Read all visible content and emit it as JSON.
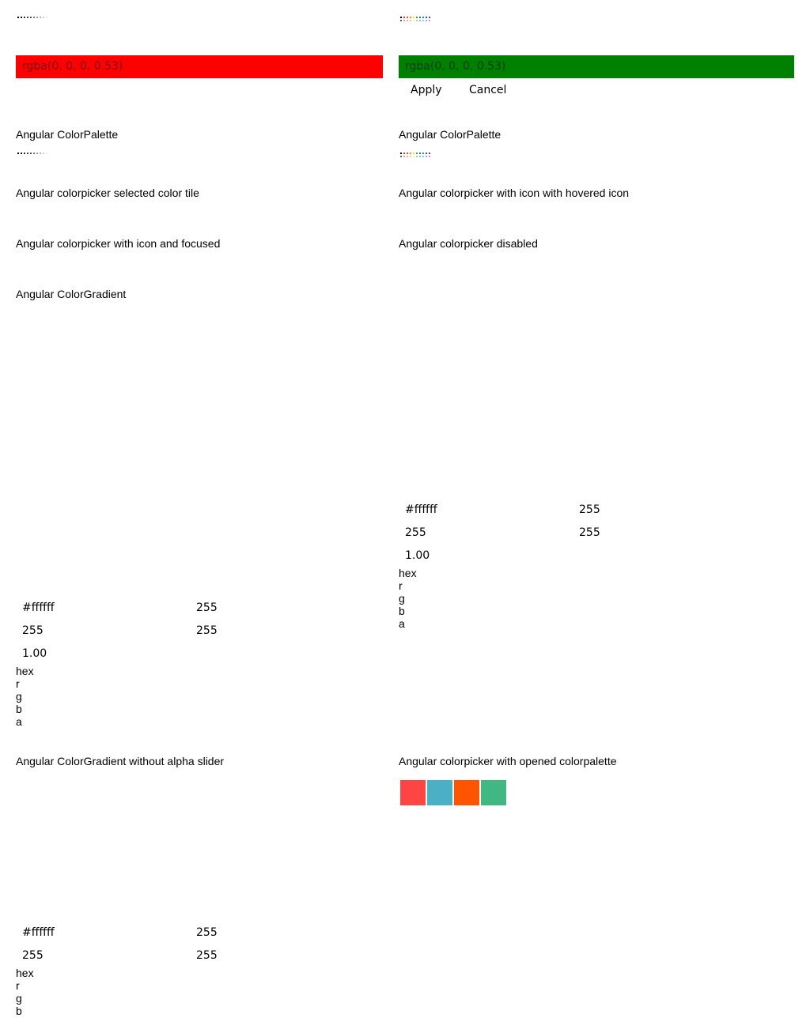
{
  "top_left": {
    "dots": [
      "#000",
      "#111",
      "#333",
      "#444",
      "#555",
      "#777",
      "#999",
      "#aaa",
      "#ccc",
      "#eee"
    ]
  },
  "top_right": {
    "dots_row1": [
      "#000",
      "#e53935",
      "#f4511e",
      "#fb8c00",
      "#fdd835",
      "#43a047",
      "#00897b",
      "#1e88e5",
      "#3949ab",
      "#8e24aa"
    ],
    "dots_row2": [
      "#616161",
      "#ef9a9a",
      "#ffab91",
      "#ffcc80",
      "#fff59d",
      "#a5d6a7",
      "#80cbc4",
      "#90caf9",
      "#9fa8da",
      "#ce93d8"
    ]
  },
  "picker_left": {
    "value": "rgba(0, 0, 0, 0.53)",
    "color": "#ff0000"
  },
  "picker_right": {
    "value": "rgba(0, 0, 0, 0.53)",
    "color": "#008000"
  },
  "actions": {
    "apply": "Apply",
    "cancel": "Cancel"
  },
  "headings": {
    "palette_left": "Angular ColorPalette",
    "palette_right": "Angular ColorPalette",
    "selected_tile": "Angular colorpicker selected color tile",
    "hovered_icon": "Angular colorpicker with icon with hovered icon",
    "focused": "Angular colorpicker with icon and focused",
    "disabled": "Angular colorpicker disabled",
    "gradient": "Angular ColorGradient",
    "gradient_no_alpha": "Angular ColorGradient without alpha slider",
    "opened_palette": "Angular colorpicker with opened colorpalette"
  },
  "gradient_right": {
    "hex": "#ffffff",
    "r": "255",
    "g": "255",
    "b": "255",
    "a": "1.00",
    "labels": [
      "hex",
      "r",
      "g",
      "b",
      "a"
    ]
  },
  "gradient_left": {
    "hex": "#ffffff",
    "r": "255",
    "g": "255",
    "b": "255",
    "a": "1.00",
    "labels": [
      "hex",
      "r",
      "g",
      "b",
      "a"
    ]
  },
  "gradient_no_alpha": {
    "hex": "#ffffff",
    "r": "255",
    "g": "255",
    "b": "255",
    "labels": [
      "hex",
      "r",
      "g",
      "b"
    ]
  },
  "opened_palette": {
    "swatches": [
      "#ff4444",
      "#4bafc6",
      "#ff5500",
      "#41b883"
    ]
  }
}
